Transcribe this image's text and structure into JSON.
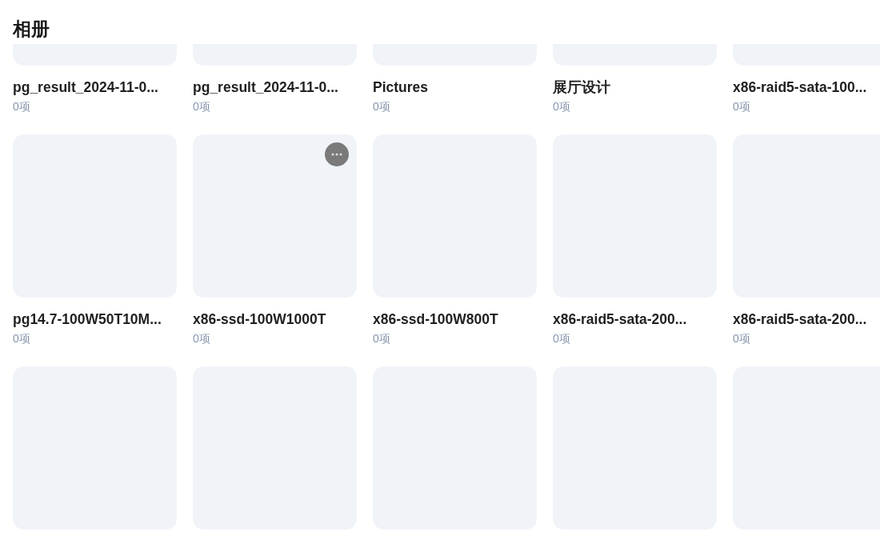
{
  "title": "相册",
  "albums": [
    {
      "kind": "album",
      "name": "pg_result_2024-11-0...",
      "count": "0项",
      "menu_button": false
    },
    {
      "kind": "album",
      "name": "pg_result_2024-11-0...",
      "count": "0项",
      "menu_button": false
    },
    {
      "kind": "album",
      "name": "Pictures",
      "count": "0项",
      "menu_button": false
    },
    {
      "kind": "album",
      "name": "展厅设计",
      "count": "0项",
      "menu_button": false
    },
    {
      "kind": "album",
      "name": "x86-raid5-sata-100...",
      "count": "0项",
      "menu_button": false
    },
    {
      "kind": "album",
      "name": "pg14.7-100W50T10M...",
      "count": "0项",
      "menu_button": false
    },
    {
      "kind": "album",
      "name": "x86-ssd-100W1000T",
      "count": "0项",
      "menu_button": true
    },
    {
      "kind": "album",
      "name": "x86-ssd-100W800T",
      "count": "0项",
      "menu_button": false
    },
    {
      "kind": "album",
      "name": "x86-raid5-sata-200...",
      "count": "0项",
      "menu_button": false
    },
    {
      "kind": "album",
      "name": "x86-raid5-sata-200...",
      "count": "0项",
      "menu_button": false
    },
    {
      "kind": "thumbnail-only"
    },
    {
      "kind": "thumbnail-only"
    },
    {
      "kind": "thumbnail-only"
    },
    {
      "kind": "thumbnail-only"
    },
    {
      "kind": "thumbnail-only"
    }
  ]
}
